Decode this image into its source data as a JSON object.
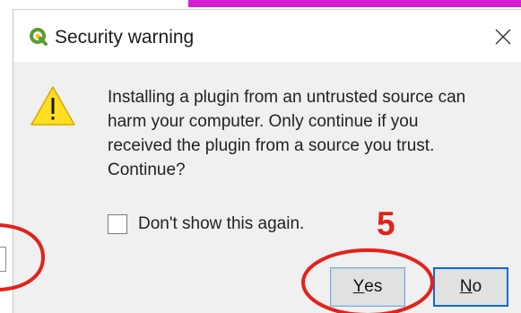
{
  "dialog": {
    "title": "Security warning",
    "message_lines": [
      "Installing a plugin from an untrusted source can",
      "harm your computer. Only continue if you",
      "received the plugin from a source you trust.",
      "Continue?"
    ],
    "checkbox": {
      "label": "Don't show this again.",
      "checked": false
    },
    "buttons": {
      "yes": {
        "mnemonic": "Y",
        "rest": "es"
      },
      "no": {
        "mnemonic": "N",
        "rest": "o"
      }
    },
    "icons": {
      "app": "qgis-logo-icon",
      "warning": "warning-triangle-icon",
      "close": "close-icon"
    }
  },
  "annotation": {
    "step_number": "5",
    "color": "#e3211a"
  },
  "colors": {
    "warning_yellow": "#ffdf1f",
    "default_button_border": "#0a6bd4",
    "canvas_magenta": "#d21fd2"
  }
}
